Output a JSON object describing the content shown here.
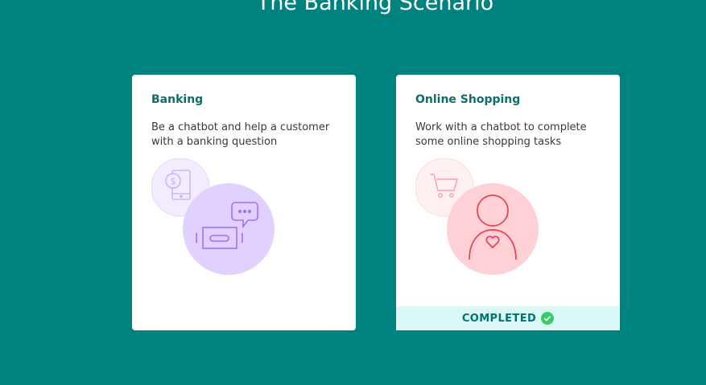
{
  "header": {
    "title": "The Banking Scenario"
  },
  "cards": [
    {
      "title": "Banking",
      "description": "Be a chatbot and help a customer with a banking question",
      "illustration": "banking-chat-illustration",
      "completed": false
    },
    {
      "title": "Online Shopping",
      "description": "Work with a chatbot to complete some online shopping tasks",
      "illustration": "shopping-customer-illustration",
      "completed": true,
      "status_label": "COMPLETED"
    }
  ],
  "colors": {
    "background": "#00837e",
    "card_title": "#0f6d6a",
    "completed_bar": "#daf8f6",
    "completed_check": "#3ccb6b",
    "banking_accent": "#a56eff",
    "shopping_accent": "#e8414f"
  }
}
